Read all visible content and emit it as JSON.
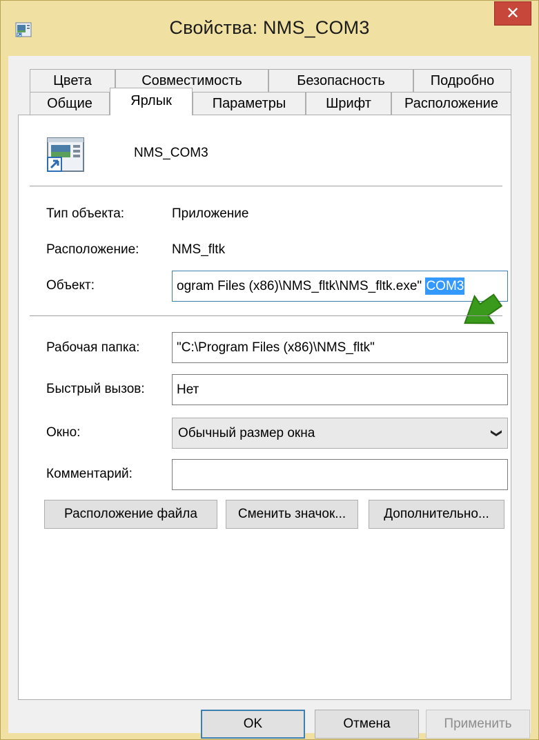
{
  "window": {
    "title": "Свойства: NMS_COM3",
    "close_glyph": "✕"
  },
  "tabs_row1": [
    "Цвета",
    "Совместимость",
    "Безопасность",
    "Подробно"
  ],
  "tabs_row2": [
    "Общие",
    "Ярлык",
    "Параметры",
    "Шрифт",
    "Расположение"
  ],
  "active_tab": "Ярлык",
  "header": {
    "name": "NMS_COM3"
  },
  "fields": {
    "type_label": "Тип объекта:",
    "type_value": "Приложение",
    "location_label": "Расположение:",
    "location_value": "NMS_fltk",
    "target_label": "Объект:",
    "target_value": "ogram Files (x86)\\NMS_fltk\\NMS_fltk.exe\" ",
    "target_selected": "COM3",
    "workdir_label": "Рабочая папка:",
    "workdir_value": "\"C:\\Program Files (x86)\\NMS_fltk\"",
    "hotkey_label": "Быстрый вызов:",
    "hotkey_value": "Нет",
    "window_label": "Окно:",
    "window_value": "Обычный размер окна",
    "comment_label": "Комментарий:",
    "comment_value": ""
  },
  "buttons": {
    "open_location": "Расположение файла",
    "change_icon": "Сменить значок...",
    "advanced": "Дополнительно...",
    "ok": "OK",
    "cancel": "Отмена",
    "apply": "Применить"
  },
  "icons": {
    "app": "window-icon",
    "shortcut": "shortcut-app-icon",
    "pointer": "green-arrow-icon",
    "chevron": "chevron-down-icon"
  },
  "colors": {
    "titlebar": "#f0e1a3",
    "close": "#c7473a",
    "selection": "#3399ff",
    "focus": "#3c7fb1",
    "arrow": "#3a9a1c"
  }
}
